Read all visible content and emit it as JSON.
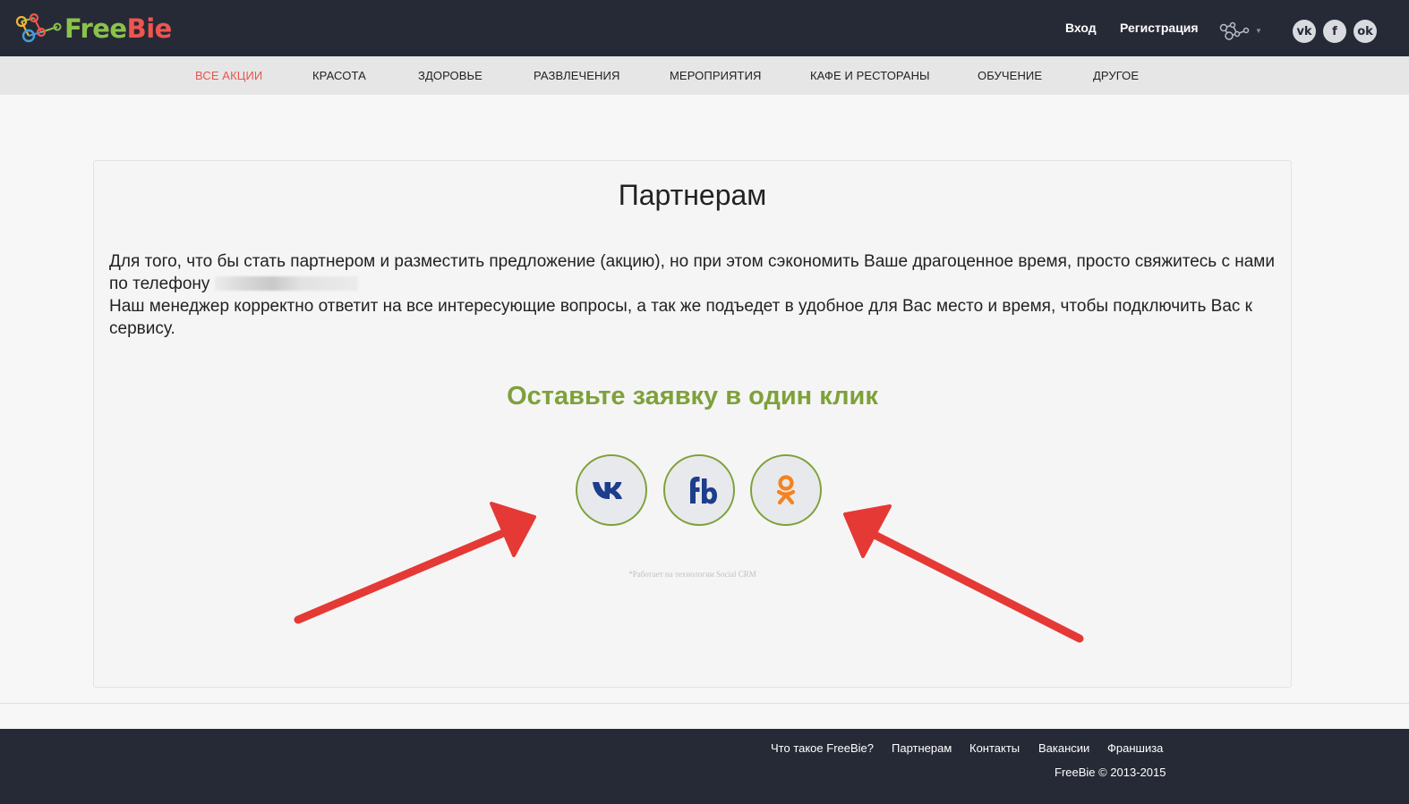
{
  "brand": {
    "name_part1": "Free",
    "name_part2": "Bie"
  },
  "header": {
    "login": "Вход",
    "register": "Регистрация",
    "social": [
      {
        "icon": "vk-icon",
        "glyph": "vk"
      },
      {
        "icon": "facebook-icon",
        "glyph": "f"
      },
      {
        "icon": "odnoklassniki-icon",
        "glyph": "ok"
      }
    ]
  },
  "categories": [
    {
      "label": "ВСЕ АКЦИИ",
      "active": true
    },
    {
      "label": "КРАСОТА",
      "active": false
    },
    {
      "label": "ЗДОРОВЬЕ",
      "active": false
    },
    {
      "label": "РАЗВЛЕЧЕНИЯ",
      "active": false
    },
    {
      "label": "МЕРОПРИЯТИЯ",
      "active": false
    },
    {
      "label": "КАФЕ И РЕСТОРАНЫ",
      "active": false
    },
    {
      "label": "ОБУЧЕНИЕ",
      "active": false
    },
    {
      "label": "ДРУГОЕ",
      "active": false
    }
  ],
  "main": {
    "title": "Партнерам",
    "intro_line1": "Для того, что бы стать партнером и разместить предложение (акцию), но при этом сэкономить Ваше драгоценное время, просто свяжитесь с нами по телефону",
    "intro_line2": "Наш менеджер корректно ответит на все интересующие вопросы, а так же подъедет в удобное для Вас место и время, чтобы подключить Вас к сервису.",
    "cta": "Оставьте заявку в один клик",
    "powered_by": "*Работает на технологии Social CRM"
  },
  "footer": {
    "links": [
      "Что такое FreeBie?",
      "Партнерам",
      "Контакты",
      "Вакансии",
      "Франшиза"
    ],
    "copyright": "FreeBie © 2013-2015"
  },
  "colors": {
    "header_bg": "#262a36",
    "accent_red": "#e5564f",
    "accent_green": "#7ea13a",
    "arrow_red": "#e53935"
  }
}
